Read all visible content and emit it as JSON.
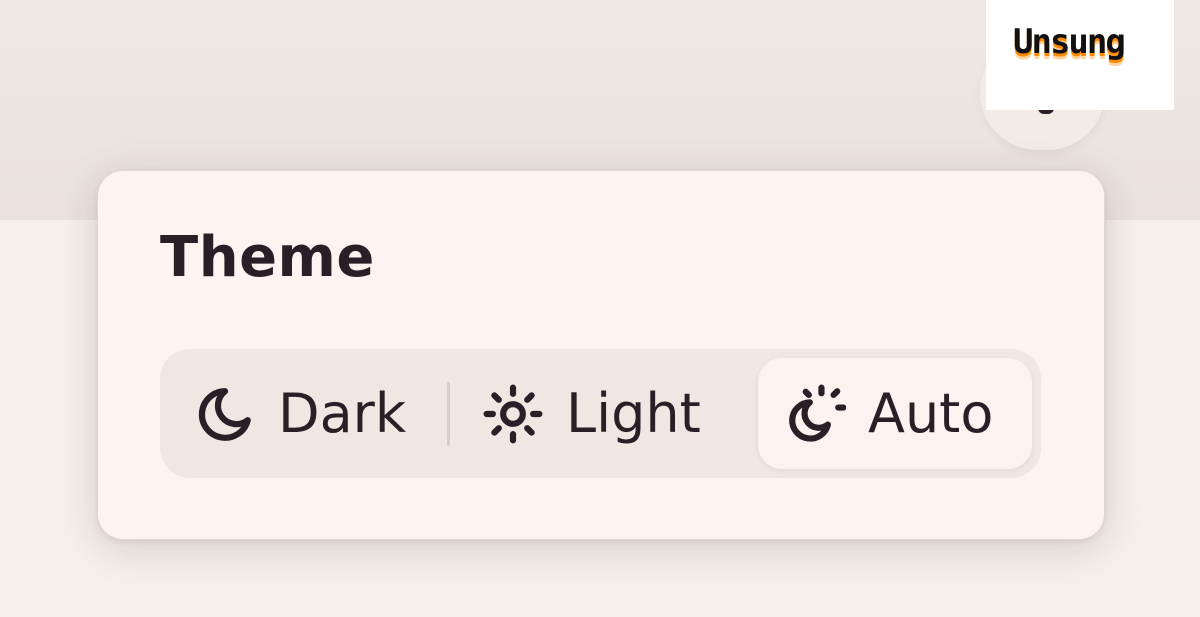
{
  "watermark": {
    "text": "Unsung"
  },
  "theme_popover": {
    "title": "Theme",
    "options": [
      {
        "label": "Dark",
        "icon": "moon-icon",
        "selected": false
      },
      {
        "label": "Light",
        "icon": "sun-icon",
        "selected": false
      },
      {
        "label": "Auto",
        "icon": "moon-sun-icon",
        "selected": true
      }
    ]
  },
  "colors": {
    "text": "#2b1f27",
    "popover_bg": "#fdf4f1",
    "segment_bg": "#f0e6e2",
    "selected_bg": "#fcf3f0",
    "watermark_accent": "#ff8a00"
  }
}
